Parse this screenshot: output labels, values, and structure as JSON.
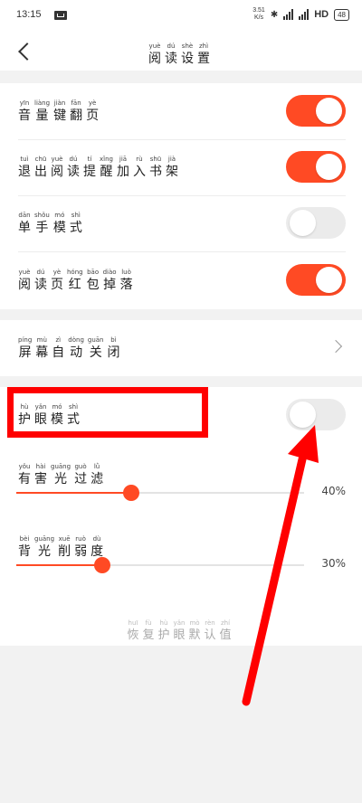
{
  "status_bar": {
    "time": "13:15",
    "speed_value": "3.51",
    "speed_unit": "K/s",
    "network": "HD",
    "battery": "48"
  },
  "nav": {
    "title": [
      {
        "py": "yuè",
        "hz": "阅"
      },
      {
        "py": "dú",
        "hz": "读"
      },
      {
        "py": "shè",
        "hz": "设"
      },
      {
        "py": "zhì",
        "hz": "置"
      }
    ]
  },
  "settings": {
    "volume_key_flip": {
      "label": [
        {
          "py": "yīn",
          "hz": "音"
        },
        {
          "py": "liàng",
          "hz": "量"
        },
        {
          "py": "jiàn",
          "hz": "键"
        },
        {
          "py": "fān",
          "hz": "翻"
        },
        {
          "py": "yè",
          "hz": "页"
        }
      ],
      "on": true
    },
    "exit_add_shelf": {
      "label": [
        {
          "py": "tuì",
          "hz": "退"
        },
        {
          "py": "chū",
          "hz": "出"
        },
        {
          "py": "yuè",
          "hz": "阅"
        },
        {
          "py": "dú",
          "hz": "读"
        },
        {
          "py": "tí",
          "hz": "提"
        },
        {
          "py": "xǐng",
          "hz": "醒"
        },
        {
          "py": "jiā",
          "hz": "加"
        },
        {
          "py": "rù",
          "hz": "入"
        },
        {
          "py": "shū",
          "hz": "书"
        },
        {
          "py": "jià",
          "hz": "架"
        }
      ],
      "on": true
    },
    "one_hand_mode": {
      "label": [
        {
          "py": "dān",
          "hz": "单"
        },
        {
          "py": "shǒu",
          "hz": "手"
        },
        {
          "py": "mó",
          "hz": "模"
        },
        {
          "py": "shì",
          "hz": "式"
        }
      ],
      "on": false
    },
    "red_packet_drop": {
      "label": [
        {
          "py": "yuè",
          "hz": "阅"
        },
        {
          "py": "dú",
          "hz": "读"
        },
        {
          "py": "yè",
          "hz": "页"
        },
        {
          "py": "hóng",
          "hz": "红"
        },
        {
          "py": "bāo",
          "hz": "包"
        },
        {
          "py": "diào",
          "hz": "掉"
        },
        {
          "py": "luò",
          "hz": "落"
        }
      ],
      "on": true
    },
    "screen_auto_off": {
      "label": [
        {
          "py": "píng",
          "hz": "屏"
        },
        {
          "py": "mù",
          "hz": "幕"
        },
        {
          "py": "zì",
          "hz": "自"
        },
        {
          "py": "dòng",
          "hz": "动"
        },
        {
          "py": "guān",
          "hz": "关"
        },
        {
          "py": "bì",
          "hz": "闭"
        }
      ]
    },
    "eye_protection": {
      "label": [
        {
          "py": "hù",
          "hz": "护"
        },
        {
          "py": "yǎn",
          "hz": "眼"
        },
        {
          "py": "mó",
          "hz": "模"
        },
        {
          "py": "shì",
          "hz": "式"
        }
      ],
      "on": false
    },
    "harmful_light_filter": {
      "label": [
        {
          "py": "yǒu",
          "hz": "有"
        },
        {
          "py": "hài",
          "hz": "害"
        },
        {
          "py": "guāng",
          "hz": "光"
        },
        {
          "py": "guò",
          "hz": "过"
        },
        {
          "py": "lǜ",
          "hz": "滤"
        }
      ],
      "value": 40,
      "value_text": "40%"
    },
    "backlight_dim": {
      "label": [
        {
          "py": "bèi",
          "hz": "背"
        },
        {
          "py": "guāng",
          "hz": "光"
        },
        {
          "py": "xuē",
          "hz": "削"
        },
        {
          "py": "ruò",
          "hz": "弱"
        },
        {
          "py": "dù",
          "hz": "度"
        }
      ],
      "value": 30,
      "value_text": "30%"
    },
    "reset_default": {
      "label": [
        {
          "py": "huī",
          "hz": "恢"
        },
        {
          "py": "fù",
          "hz": "复"
        },
        {
          "py": "hù",
          "hz": "护"
        },
        {
          "py": "yǎn",
          "hz": "眼"
        },
        {
          "py": "mò",
          "hz": "默"
        },
        {
          "py": "rèn",
          "hz": "认"
        },
        {
          "py": "zhí",
          "hz": "值"
        }
      ]
    }
  },
  "colors": {
    "accent": "#ff4a24",
    "annotation": "#ff0000"
  }
}
